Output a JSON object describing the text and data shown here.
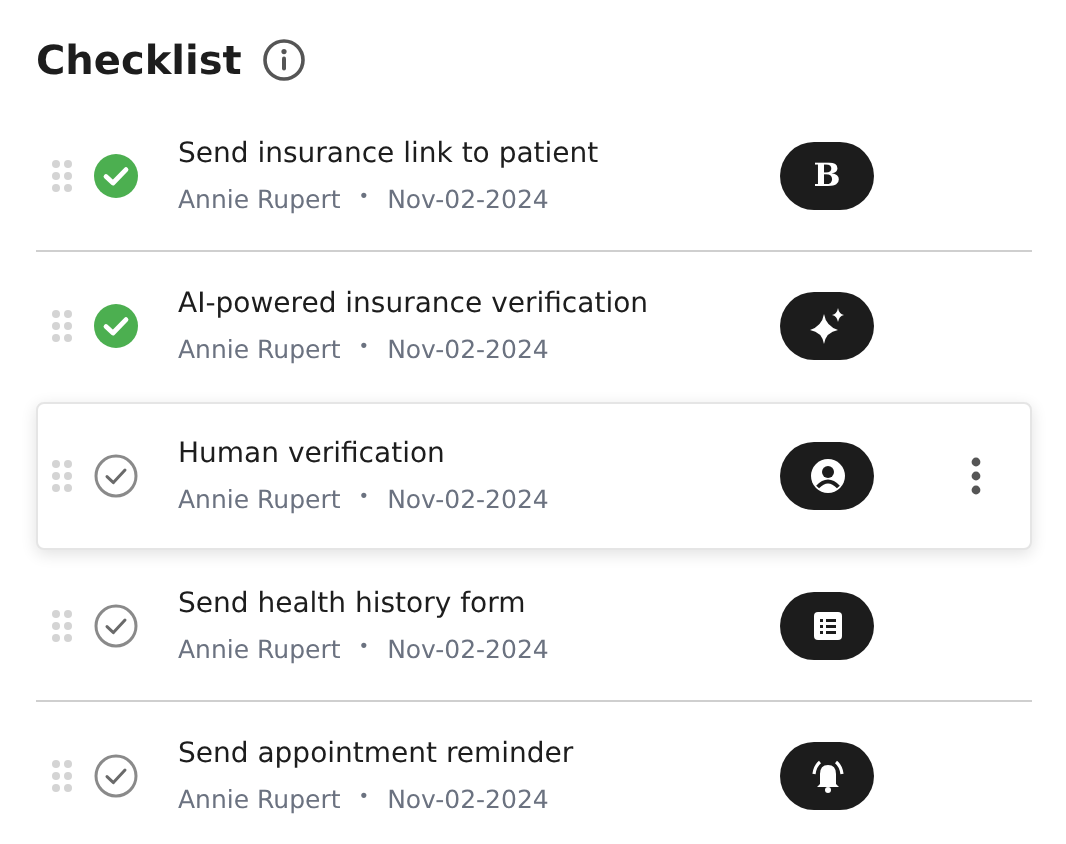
{
  "title": "Checklist",
  "items": [
    {
      "title": "Send insurance link to patient",
      "assignee": "Annie Rupert",
      "separator": "•",
      "date": "Nov-02-2024",
      "checked": true,
      "selected": false,
      "action": {
        "kind": "letter",
        "text": "B"
      }
    },
    {
      "title": "AI-powered insurance verification",
      "assignee": "Annie Rupert",
      "separator": "•",
      "date": "Nov-02-2024",
      "checked": true,
      "selected": false,
      "action": {
        "kind": "sparkle"
      }
    },
    {
      "title": "Human verification",
      "assignee": "Annie Rupert",
      "separator": "•",
      "date": "Nov-02-2024",
      "checked": false,
      "selected": true,
      "action": {
        "kind": "person"
      }
    },
    {
      "title": "Send health history form",
      "assignee": "Annie Rupert",
      "separator": "•",
      "date": "Nov-02-2024",
      "checked": false,
      "selected": false,
      "action": {
        "kind": "list"
      }
    },
    {
      "title": "Send appointment reminder",
      "assignee": "Annie Rupert",
      "separator": "•",
      "date": "Nov-02-2024",
      "checked": false,
      "selected": false,
      "action": {
        "kind": "bell"
      }
    }
  ]
}
